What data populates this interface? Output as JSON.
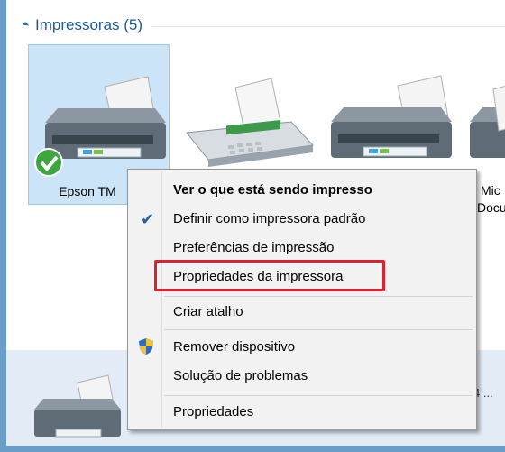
{
  "group": {
    "title": "Impressoras (5)"
  },
  "devices": [
    {
      "label": "Epson TM",
      "icon": "printer-default-icon"
    },
    {
      "label": "",
      "icon": "fax-icon"
    },
    {
      "label": "",
      "icon": "printer-icon"
    },
    {
      "label": "Mic",
      "label2": "Docu",
      "icon": "printer-icon"
    }
  ],
  "bottom_device": {
    "text": "4 ..."
  },
  "context_menu": {
    "items": [
      {
        "label": "Ver o que está sendo impresso",
        "bold": true
      },
      {
        "label": "Definir como impressora padrão",
        "checked": true
      },
      {
        "label": "Preferências de impressão"
      },
      {
        "label": "Propriedades da impressora",
        "highlighted": true
      },
      {
        "label": "Criar atalho"
      },
      {
        "label": "Remover dispositivo",
        "icon": "shield-icon"
      },
      {
        "label": "Solução de problemas"
      },
      {
        "label": "Propriedades"
      }
    ]
  },
  "colors": {
    "accent": "#1e5a9c",
    "selection": "#cce4f7",
    "highlight_border": "#e02030",
    "frame": "#6a9dc8"
  }
}
